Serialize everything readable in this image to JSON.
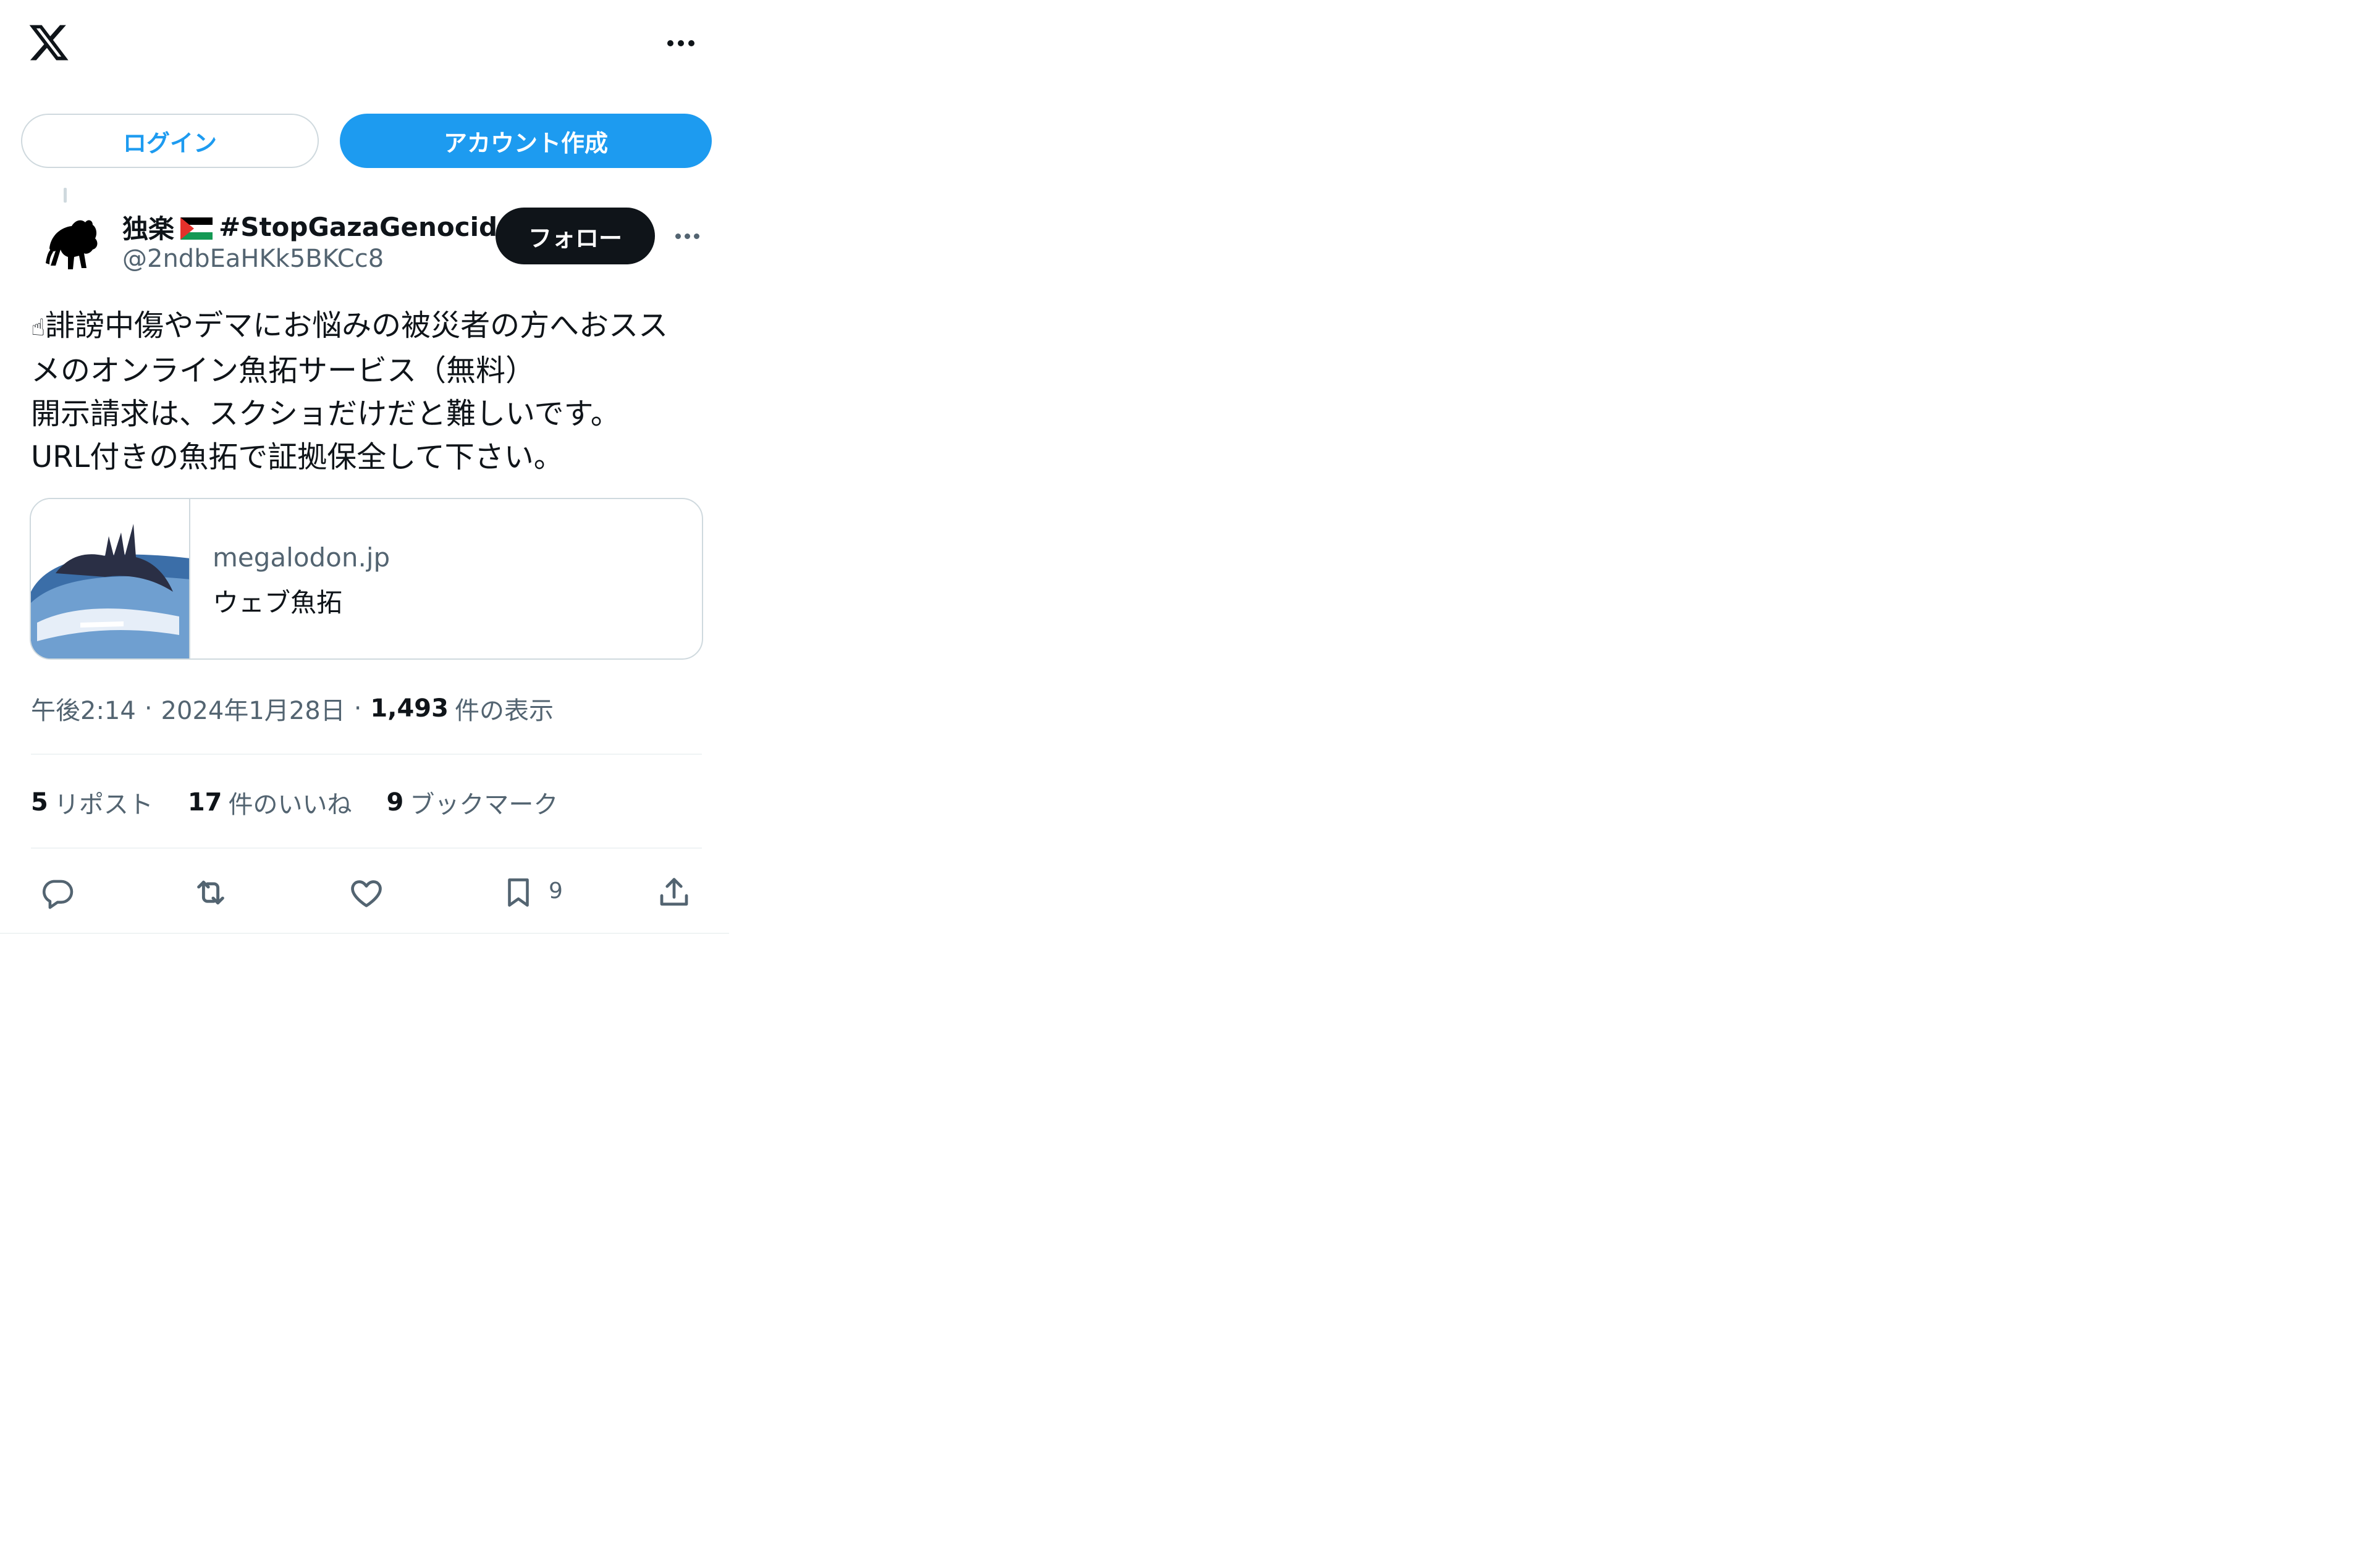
{
  "header": {
    "logo_icon": "x-logo-icon",
    "more_icon": "more-dots-icon"
  },
  "auth": {
    "login_label": "ログイン",
    "signup_label": "アカウント作成"
  },
  "author": {
    "name": "独楽",
    "flag_icon": "palestine-flag-icon",
    "hashtag": "#StopGazaGenocide",
    "handle": "@2ndbEaHKk5BKCc8",
    "avatar_icon": "black-cat-avatar-icon",
    "follow_label": "フォロー"
  },
  "tweet": {
    "lead_icon": "pointing-finger-emoji-icon",
    "lines": [
      "誹謗中傷やデマにお悩みの被災者の方へおスス",
      "メのオンライン魚拓サービス（無料）",
      "開示請求は、スクショだけだと難しいです。",
      "URL付きの魚拓で証拠保全して下さい。"
    ]
  },
  "link_card": {
    "domain": "megalodon.jp",
    "title": "ウェブ魚拓",
    "thumbnail_icon": "megalodon-earth-thumbnail"
  },
  "meta": {
    "time": "午後2:14",
    "date": "2024年1月28日",
    "separator": "·",
    "views_count": "1,493",
    "views_label": "件の表示"
  },
  "stats": {
    "reposts_count": "5",
    "reposts_label": "リポスト",
    "likes_count": "17",
    "likes_label": "件のいいね",
    "bookmarks_count": "9",
    "bookmarks_label": "ブックマーク"
  },
  "actions": {
    "reply_icon": "reply-icon",
    "repost_icon": "repost-icon",
    "like_icon": "heart-icon",
    "bookmark_icon": "bookmark-icon",
    "bookmark_count": "9",
    "share_icon": "share-icon"
  },
  "colors": {
    "accent": "#1d9bf0",
    "text_primary": "#0f1419",
    "text_secondary": "#536471",
    "border": "#cfd9de"
  }
}
